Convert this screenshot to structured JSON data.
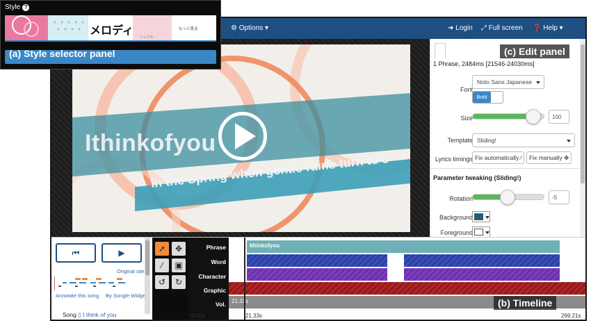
{
  "navbar": {
    "options": "Options",
    "login": "Login",
    "fullscreen": "Full screen",
    "help": "Help"
  },
  "video": {
    "lyric_main": "Ithinkofyou",
    "lyric_sub": "In the Spring when gentle rains turn to s"
  },
  "edit_panel": {
    "header": "1 Phrase, 2484ms [21546-24030ms]",
    "font_label": "Font",
    "font_value": "Noto Sans Japanese",
    "bold_label": "Bold",
    "size_label": "Size",
    "size_value": "100",
    "size_level": 0.85,
    "template_label": "Template",
    "template_value": "Sliding!",
    "lyrics_timings_label": "Lyrics timings",
    "fix_auto": "Fix automatically",
    "fix_manual": "Fix manually",
    "param_heading": "Parameter tweaking (Sliding!)",
    "rotation_label": "Rotation",
    "rotation_value": "-5",
    "background_label": "Background",
    "background_color": "#16637a",
    "foreground_label": "Foreground",
    "foreground_color": "#ffffff"
  },
  "player": {
    "prev_symbol": "⏮",
    "play_symbol": "▶",
    "original_site": "Original site",
    "annotate": "Annotate this song",
    "by_widget": "By Songle Widget",
    "song_label": "Song",
    "song_title": "I think of you"
  },
  "timeline": {
    "labels": [
      "Phrase",
      "Word",
      "Character",
      "Graphic",
      "Vol."
    ],
    "phrase_text": "Ithinkofyou",
    "vol_text": "21.33s",
    "time_start": "0.00s",
    "time_cursor": "21.33s",
    "time_end": "269.21s"
  },
  "style_panel": {
    "title": "Style",
    "help_icon": "?",
    "thumb_text_melody": "メロディー",
    "thumb_text_small": "もっと見る",
    "thumb_caption_simple": "シンプル"
  },
  "annotations": {
    "a": "(a) Style selector panel",
    "b": "(b) Timeline",
    "c": "(c) Edit panel"
  },
  "colors": {
    "navbar": "#1d4f82",
    "slider_green": "#5cb85c",
    "bold_blue": "#3a87c8",
    "play_accent": "#f28a3a"
  }
}
